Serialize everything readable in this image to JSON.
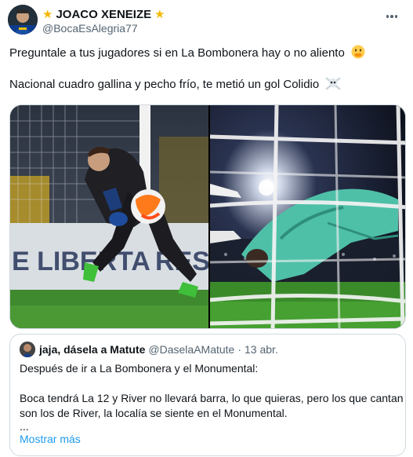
{
  "author": {
    "display_name": "JOACO XENEIZE",
    "handle": "@BocaEsAlegria77",
    "badge_icon": "star-icon",
    "avatar_icon": "profile-avatar"
  },
  "more_icon": "more-options-icon",
  "tweet": {
    "line1": "Preguntale a tus jugadores si en La Bombonera hay o no aliento",
    "line1_emoji": "face-with-hand-over-mouth-icon",
    "line2": "Nacional cuadro gallina y pecho frío, te metió un gol Colidio",
    "line2_emoji": "skull-and-crossbones-icon"
  },
  "media": {
    "left_photo": "goalkeeper-diving-save-photo",
    "right_photo": "goalkeeper-behind-net-photo"
  },
  "quote": {
    "display_name": "jaja, dásela a Matute",
    "handle": "@DaselaAMatute",
    "separator": "·",
    "date": "13 abr.",
    "line1": "Después de ir a La Bombonera y el Monumental:",
    "line2": "Boca tendrá La 12 y River no llevará barra, lo que quieras, pero los que cantan",
    "line3": "son los de River, la localía se siente en el Monumental.",
    "line4": "...",
    "show_more": "Mostrar más"
  },
  "colors": {
    "text": "#0f1419",
    "secondary": "#536471",
    "link": "#1d9bf0",
    "border": "#cfd9de",
    "star": "#f5b800",
    "pitch_green": "#3f8a2e",
    "keeper_kit": "#4fc0a8"
  }
}
